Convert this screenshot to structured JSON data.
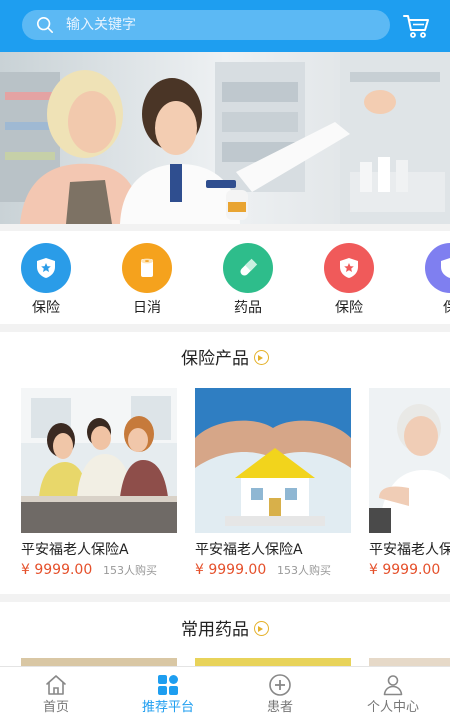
{
  "header": {
    "search_placeholder": "输入关键字",
    "search_icon": "search-icon",
    "cart_icon": "cart-icon"
  },
  "banner": {
    "image": "pharmacist-and-customer-photo"
  },
  "categories": [
    {
      "label": "保险",
      "icon": "shield-star-icon",
      "color": "#2a9ce8"
    },
    {
      "label": "日消",
      "icon": "tissue-roll-icon",
      "color": "#f5a21d"
    },
    {
      "label": "药品",
      "icon": "capsule-icon",
      "color": "#2ebd8b"
    },
    {
      "label": "保险",
      "icon": "shield-star-icon",
      "color": "#f05a5a"
    },
    {
      "label": "保",
      "icon": "shield-star-icon",
      "color": "#7f7ff0"
    }
  ],
  "insurance_section": {
    "title": "保险产品",
    "products": [
      {
        "name": "平安福老人保险A",
        "price": "¥ 9999.00",
        "sold": "153人购买",
        "image": "family-photo"
      },
      {
        "name": "平安福老人保险A",
        "price": "¥ 9999.00",
        "sold": "153人购买",
        "image": "house-in-hands-photo"
      },
      {
        "name": "平安福老人保",
        "price": "¥ 9999.00",
        "sold": "",
        "image": "elderly-woman-photo"
      }
    ]
  },
  "medicine_section": {
    "title": "常用药品"
  },
  "tabbar": {
    "items": [
      {
        "label": "首页",
        "icon": "home-icon",
        "active": false
      },
      {
        "label": "推荐平台",
        "icon": "grid-icon",
        "active": true
      },
      {
        "label": "患者",
        "icon": "plus-circle-icon",
        "active": false
      },
      {
        "label": "个人中心",
        "icon": "person-icon",
        "active": false
      }
    ]
  },
  "colors": {
    "accent": "#1e9ef0",
    "price": "#e5502b",
    "section_arrow": "#e5b12a"
  }
}
